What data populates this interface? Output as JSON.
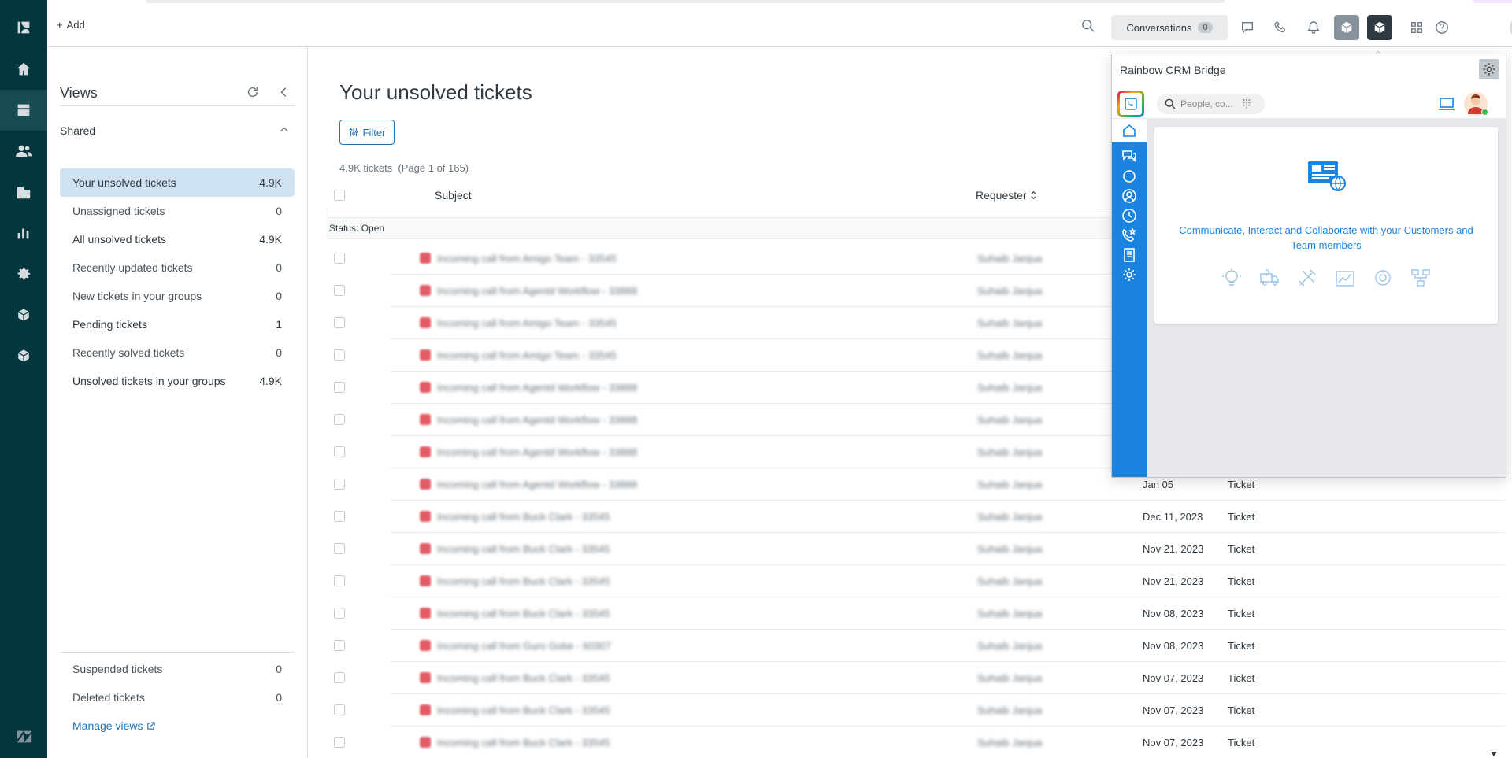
{
  "topbar": {
    "add_label": "Add",
    "conversations_label": "Conversations",
    "conversations_count": "0"
  },
  "views": {
    "title": "Views",
    "shared_label": "Shared",
    "items": [
      {
        "label": "Your unsolved tickets",
        "count": "4.9K"
      },
      {
        "label": "Unassigned tickets",
        "count": "0"
      },
      {
        "label": "All unsolved tickets",
        "count": "4.9K"
      },
      {
        "label": "Recently updated tickets",
        "count": "0"
      },
      {
        "label": "New tickets in your groups",
        "count": "0"
      },
      {
        "label": "Pending tickets",
        "count": "1"
      },
      {
        "label": "Recently solved tickets",
        "count": "0"
      },
      {
        "label": "Unsolved tickets in your groups",
        "count": "4.9K"
      }
    ],
    "bottom_items": [
      {
        "label": "Suspended tickets",
        "count": "0"
      },
      {
        "label": "Deleted tickets",
        "count": "0"
      }
    ],
    "manage_label": "Manage views"
  },
  "main": {
    "title": "Your unsolved tickets",
    "filter_label": "Filter",
    "count_text": "4.9K tickets  (Page 1 of 165)",
    "col_subject": "Subject",
    "col_requester": "Requester",
    "status_group": "Status: Open",
    "rows": [
      {
        "subject": "Incoming call from Amigo Team - 33545",
        "requester": "Suhaib Janjua",
        "date": "",
        "type": ""
      },
      {
        "subject": "Incoming call from Agentd Workflow - 33888",
        "requester": "Suhaib Janjua",
        "date": "",
        "type": ""
      },
      {
        "subject": "Incoming call from Amigo Team - 33545",
        "requester": "Suhaib Janjua",
        "date": "",
        "type": ""
      },
      {
        "subject": "Incoming call from Amigo Team - 33545",
        "requester": "Suhaib Janjua",
        "date": "",
        "type": ""
      },
      {
        "subject": "Incoming call from Agentd Workflow - 33888",
        "requester": "Suhaib Janjua",
        "date": "",
        "type": ""
      },
      {
        "subject": "Incoming call from Agentd Workflow - 33888",
        "requester": "Suhaib Janjua",
        "date": "",
        "type": ""
      },
      {
        "subject": "Incoming call from Agentd Workflow - 33888",
        "requester": "Suhaib Janjua",
        "date": "",
        "type": ""
      },
      {
        "subject": "Incoming call from Agentd Workflow - 33888",
        "requester": "Suhaib Janjua",
        "date": "Jan 05",
        "type": "Ticket"
      },
      {
        "subject": "Incoming call from Buck Clark - 33545",
        "requester": "Suhaib Janjua",
        "date": "Dec 11, 2023",
        "type": "Ticket"
      },
      {
        "subject": "Incoming call from Buck Clark - 33545",
        "requester": "Suhaib Janjua",
        "date": "Nov 21, 2023",
        "type": "Ticket"
      },
      {
        "subject": "Incoming call from Buck Clark - 33545",
        "requester": "Suhaib Janjua",
        "date": "Nov 21, 2023",
        "type": "Ticket"
      },
      {
        "subject": "Incoming call from Buck Clark - 33545",
        "requester": "Suhaib Janjua",
        "date": "Nov 08, 2023",
        "type": "Ticket"
      },
      {
        "subject": "Incoming call from Guro Gobe - 60307",
        "requester": "Suhaib Janjua",
        "date": "Nov 08, 2023",
        "type": "Ticket"
      },
      {
        "subject": "Incoming call from Buck Clark - 33545",
        "requester": "Suhaib Janjua",
        "date": "Nov 07, 2023",
        "type": "Ticket"
      },
      {
        "subject": "Incoming call from Buck Clark - 33545",
        "requester": "Suhaib Janjua",
        "date": "Nov 07, 2023",
        "type": "Ticket"
      },
      {
        "subject": "Incoming call from Buck Clark - 33545",
        "requester": "Suhaib Janjua",
        "date": "Nov 07, 2023",
        "type": "Ticket"
      }
    ]
  },
  "crm": {
    "title": "Rainbow CRM Bridge",
    "search_placeholder": "People, co...",
    "tagline": "Communicate, Interact and Collaborate with your Customers and Team members"
  },
  "colors": {
    "nav_bg": "#03363d",
    "accent_blue": "#1f73b7",
    "active_view_bg": "#cfe2f2",
    "crm_blue": "#1b84e0",
    "priority_red": "#e35b66"
  }
}
